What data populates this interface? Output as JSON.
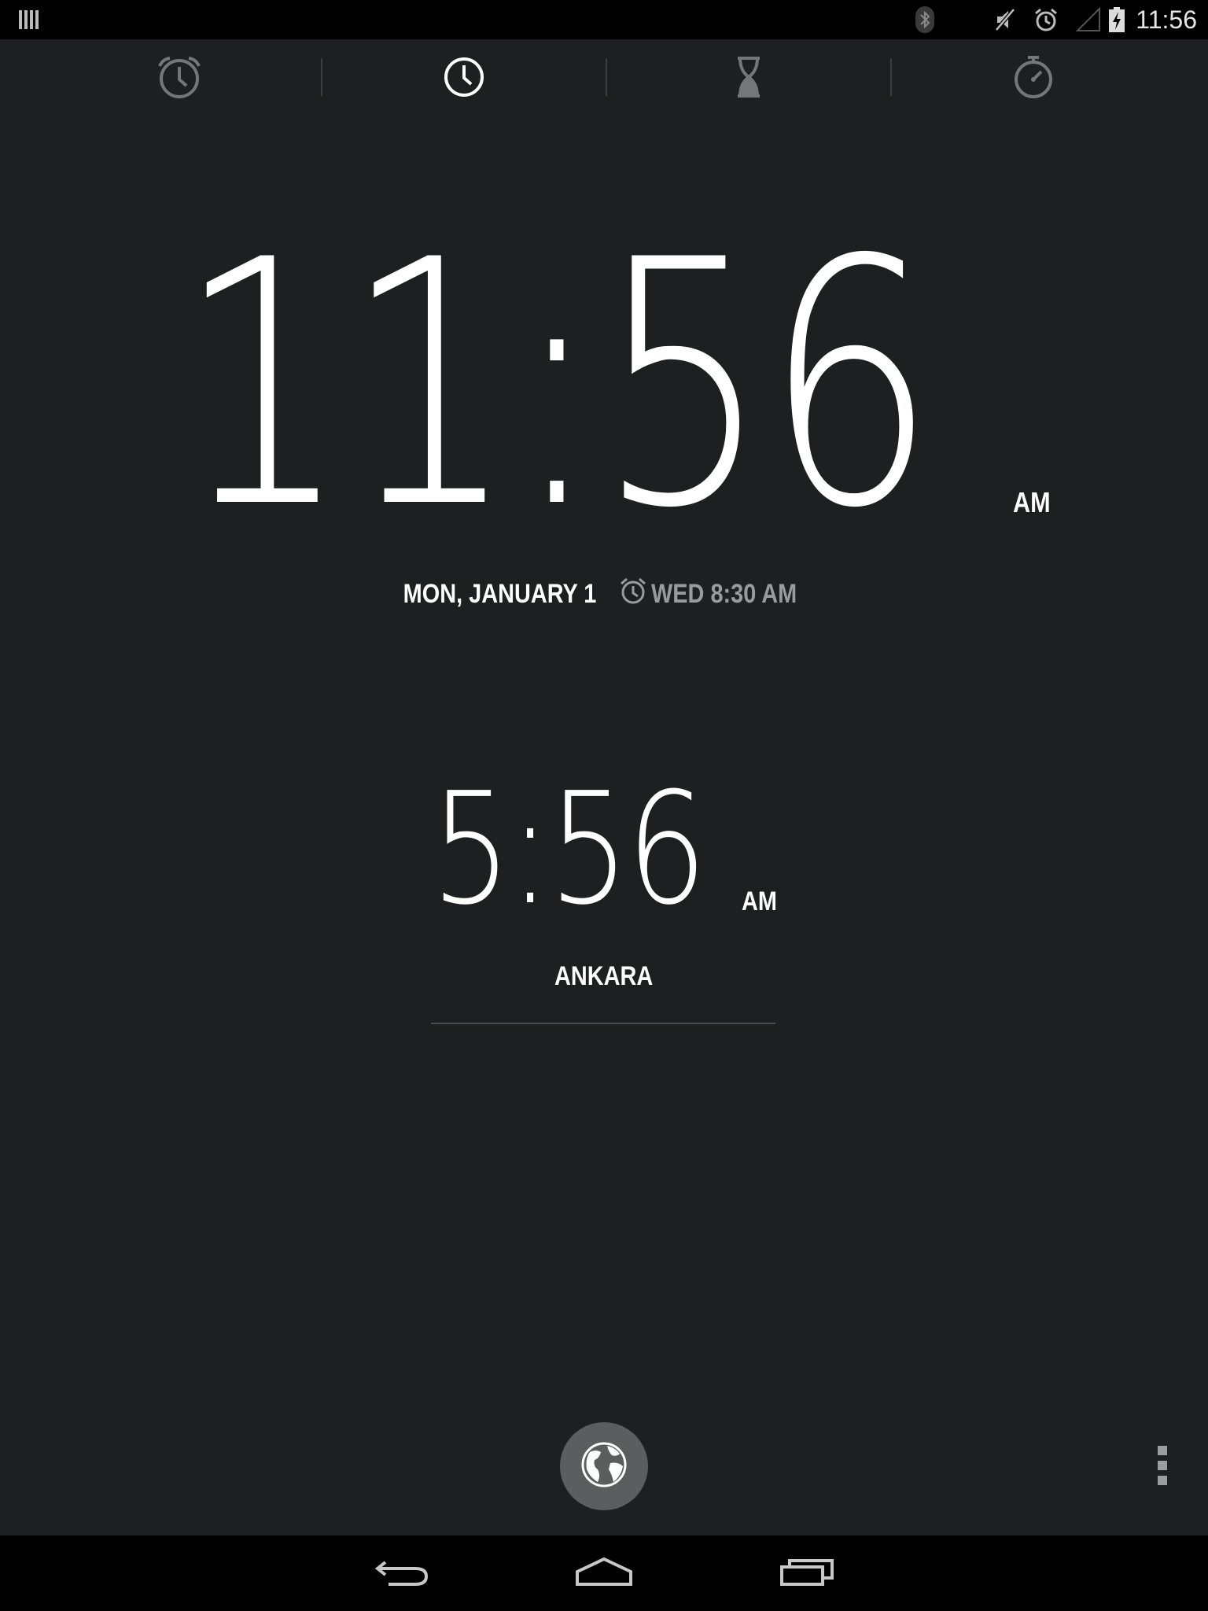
{
  "status_bar": {
    "time": "11:56",
    "icons": [
      "notification-bars-icon",
      "bluetooth-icon",
      "mute-icon",
      "alarm-icon",
      "signal-icon",
      "battery-charging-icon"
    ]
  },
  "tabs": [
    {
      "name": "alarm",
      "icon": "alarm-clock-icon",
      "selected": false
    },
    {
      "name": "clock",
      "icon": "clock-icon",
      "selected": true
    },
    {
      "name": "timer",
      "icon": "hourglass-icon",
      "selected": false
    },
    {
      "name": "stopwatch",
      "icon": "stopwatch-icon",
      "selected": false
    }
  ],
  "main_clock": {
    "time": "11:56",
    "ampm": "AM",
    "date": "MON, JANUARY 1",
    "next_alarm": "WED 8:30 AM"
  },
  "world_clock": {
    "time": "5:56",
    "ampm": "AM",
    "city": "ANKARA"
  },
  "colors": {
    "background": "#1e1f21",
    "bars": "#000000",
    "text": "#ffffff",
    "muted_text": "#9a9b9d",
    "globe_button": "#5c5d5f"
  }
}
